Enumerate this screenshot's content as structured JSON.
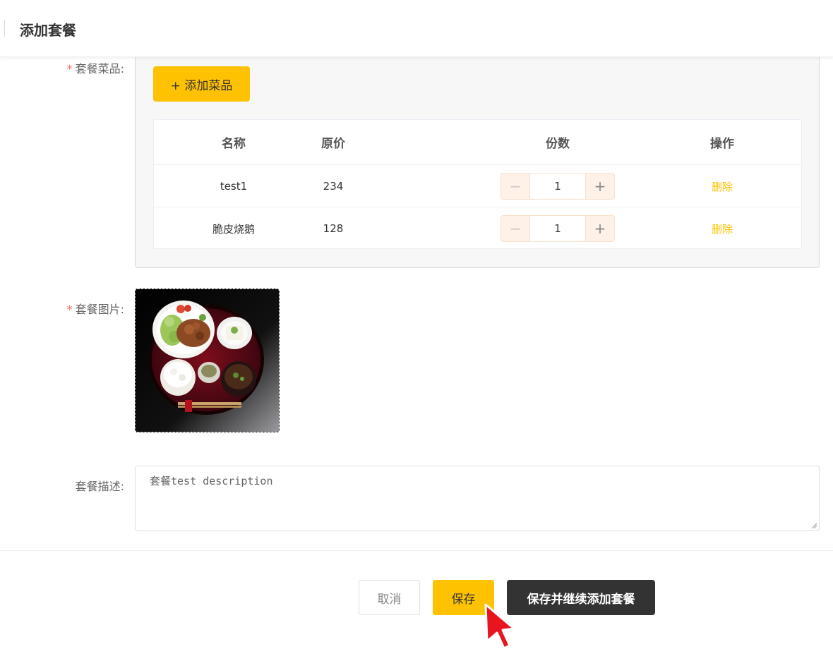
{
  "header": {
    "title": "添加套餐"
  },
  "form": {
    "dishes_label": "套餐菜品:",
    "image_label": "套餐图片:",
    "desc_label": "套餐描述:",
    "required_mark": "*",
    "add_dish_label": "+ 添加菜品",
    "columns": {
      "name": "名称",
      "price": "原价",
      "qty": "份数",
      "op": "操作"
    },
    "rows": [
      {
        "name": "test1",
        "price": "234",
        "qty": "1",
        "op": "删除"
      },
      {
        "name": "脆皮烧鹅",
        "price": "128",
        "qty": "1",
        "op": "删除"
      }
    ],
    "stepper": {
      "minus": "−",
      "plus": "+"
    },
    "description": "套餐test description"
  },
  "actions": {
    "cancel": "取消",
    "save": "保存",
    "save_continue": "保存并继续添加套餐"
  },
  "colors": {
    "accent": "#ffc200",
    "dark": "#333333",
    "required": "#f56c6c"
  }
}
